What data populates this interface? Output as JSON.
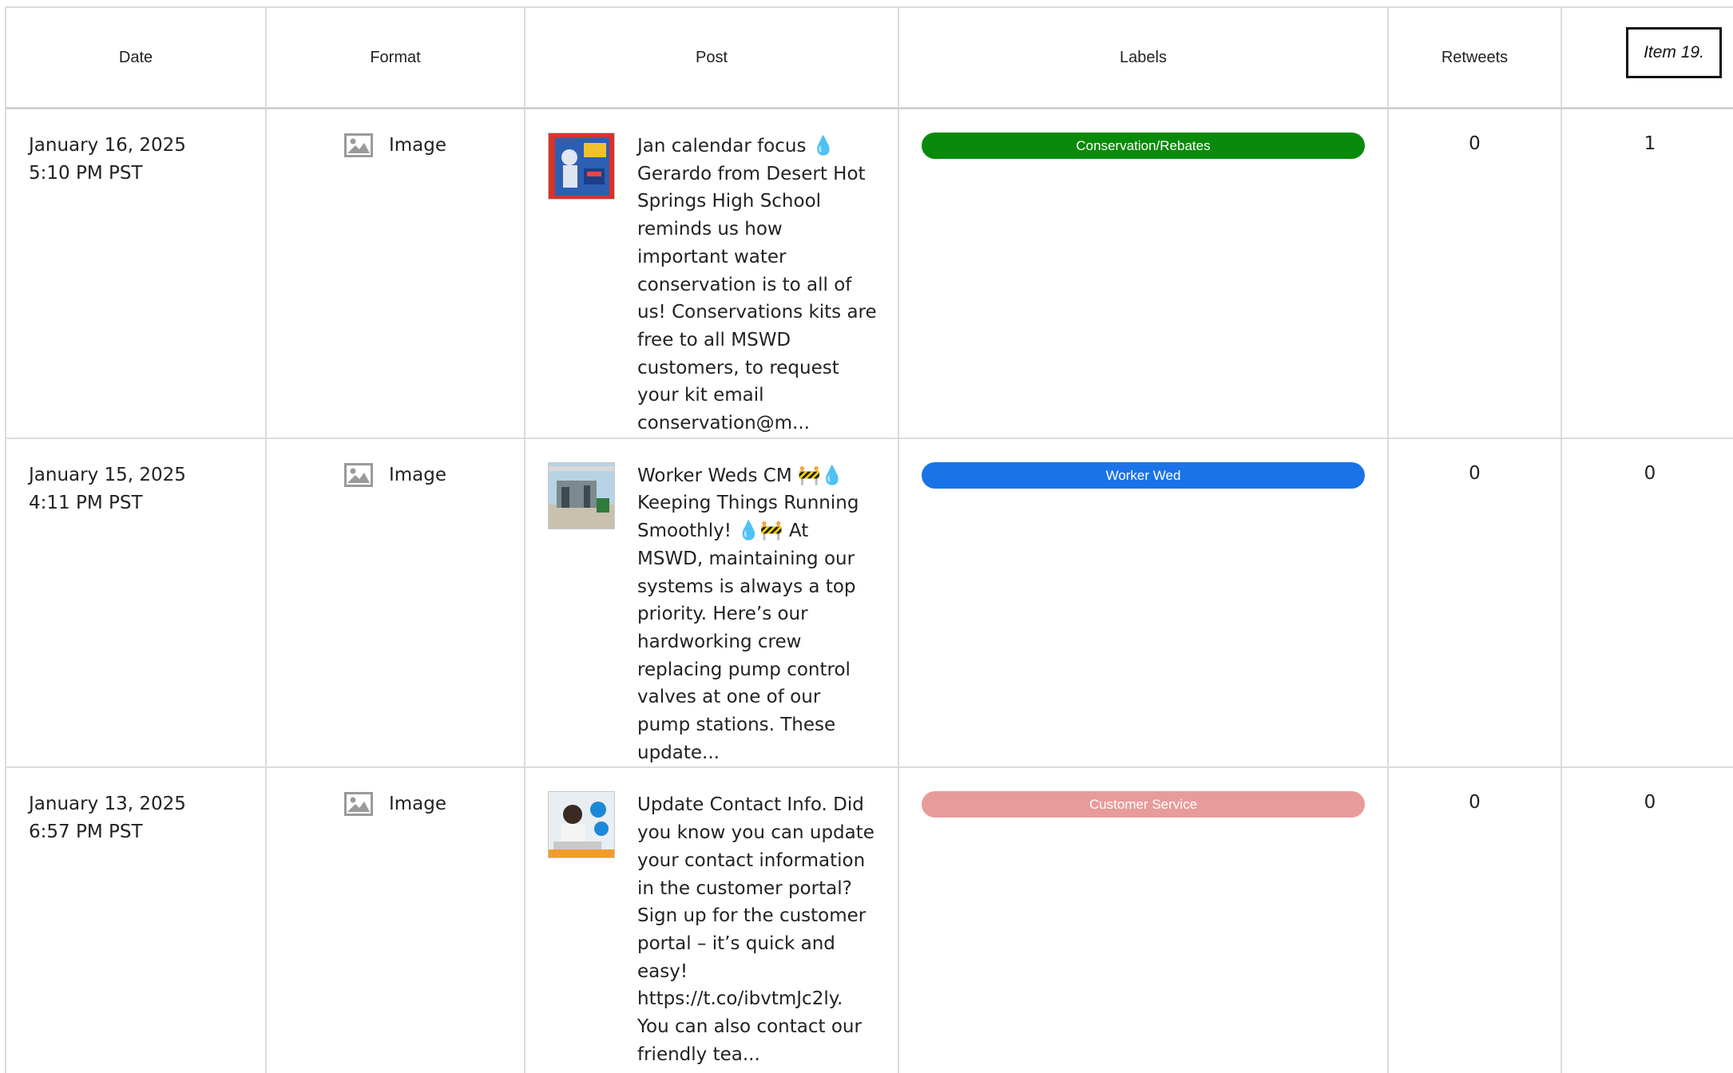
{
  "columns": {
    "date": "Date",
    "format": "Format",
    "post": "Post",
    "labels": "Labels",
    "retweets": "Retweets"
  },
  "item_badge": "Item 19.",
  "rows": [
    {
      "date": "January 16, 2025",
      "time": "5:10 PM PST",
      "format_icon": "image-icon",
      "format": "Image",
      "post_text": "Jan calendar focus 💧Gerardo from Desert Hot Springs High School reminds us how important water conservation is to all of us! Conservations kits are free to all MSWD customers, to request your kit email conservation@m...",
      "label": "Conservation/Rebates",
      "label_color": "#0a8a0a",
      "retweets": "0",
      "item_col": "1"
    },
    {
      "date": "January 15, 2025",
      "time": "4:11 PM PST",
      "format_icon": "image-icon",
      "format": "Image",
      "post_text": "Worker Weds CM 🚧💧 Keeping Things Running Smoothly! 💧🚧 At MSWD, maintaining our systems is always a top priority. Here’s our hardworking crew replacing pump control valves at one of our pump stations. These update...",
      "label": "Worker Wed",
      "label_color": "#1a73e8",
      "retweets": "0",
      "item_col": "0"
    },
    {
      "date": "January 13, 2025",
      "time": "6:57 PM PST",
      "format_icon": "image-icon",
      "format": "Image",
      "post_text": "Update Contact Info. Did you know you can update your contact information in the customer portal? Sign up for the customer portal – it’s quick and easy! https://t.co/ibvtmJc2ly. You can also contact our friendly tea...",
      "label": "Customer Service",
      "label_color": "#e89b9b",
      "retweets": "0",
      "item_col": "0"
    }
  ]
}
